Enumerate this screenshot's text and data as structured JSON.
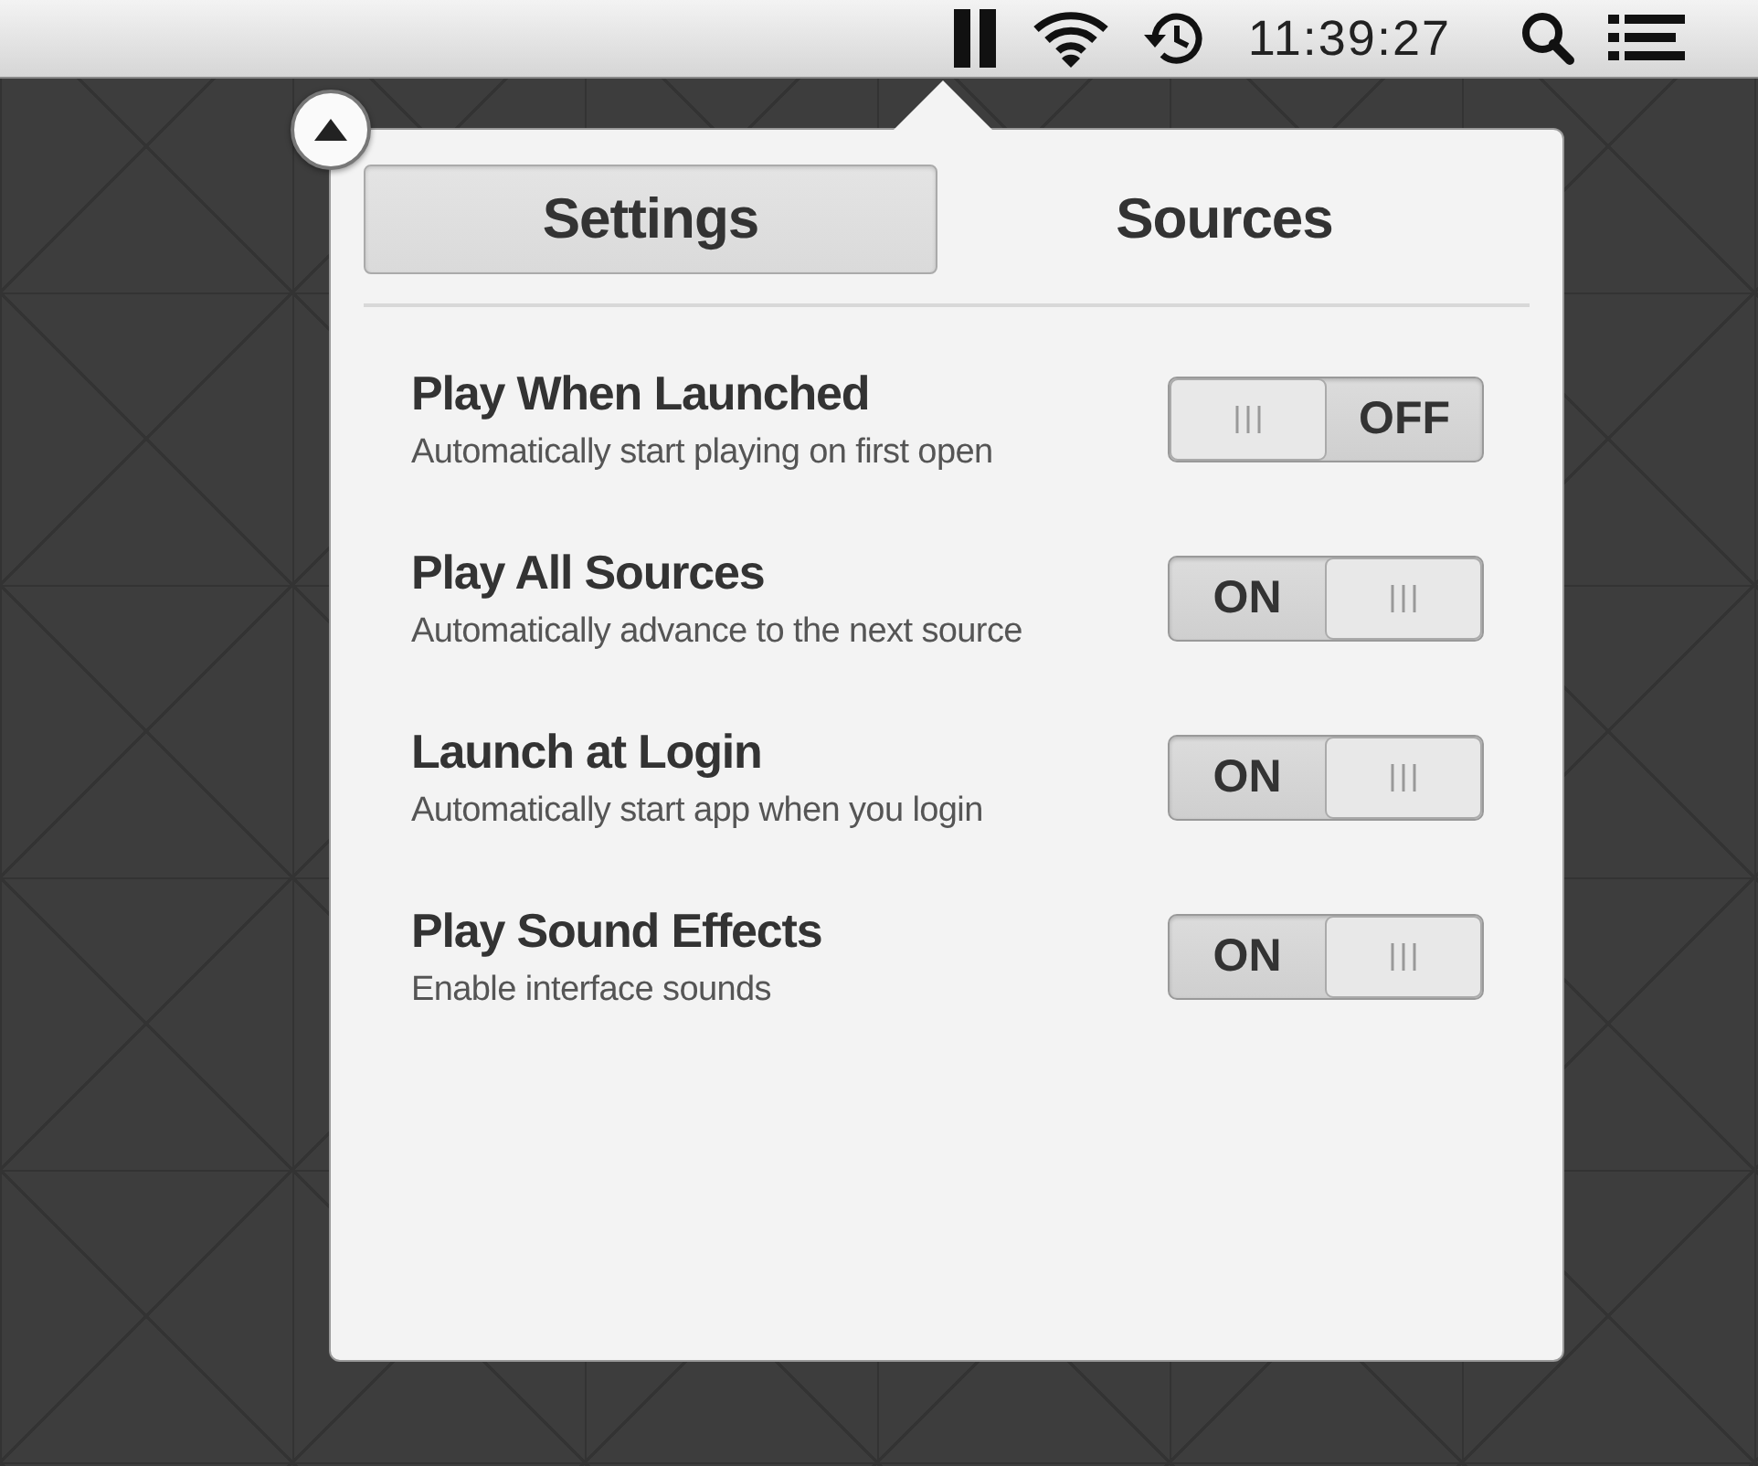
{
  "menubar": {
    "clock": "11:39:27"
  },
  "popover": {
    "tabs": [
      {
        "label": "Settings",
        "selected": true
      },
      {
        "label": "Sources",
        "selected": false
      }
    ],
    "settings": [
      {
        "title": "Play When Launched",
        "description": "Automatically start playing on first open",
        "on": false,
        "state_label": "OFF"
      },
      {
        "title": "Play All Sources",
        "description": "Automatically advance to the next source",
        "on": true,
        "state_label": "ON"
      },
      {
        "title": "Launch at Login",
        "description": "Automatically start app when you login",
        "on": true,
        "state_label": "ON"
      },
      {
        "title": "Play Sound Effects",
        "description": "Enable interface sounds",
        "on": true,
        "state_label": "ON"
      }
    ]
  }
}
